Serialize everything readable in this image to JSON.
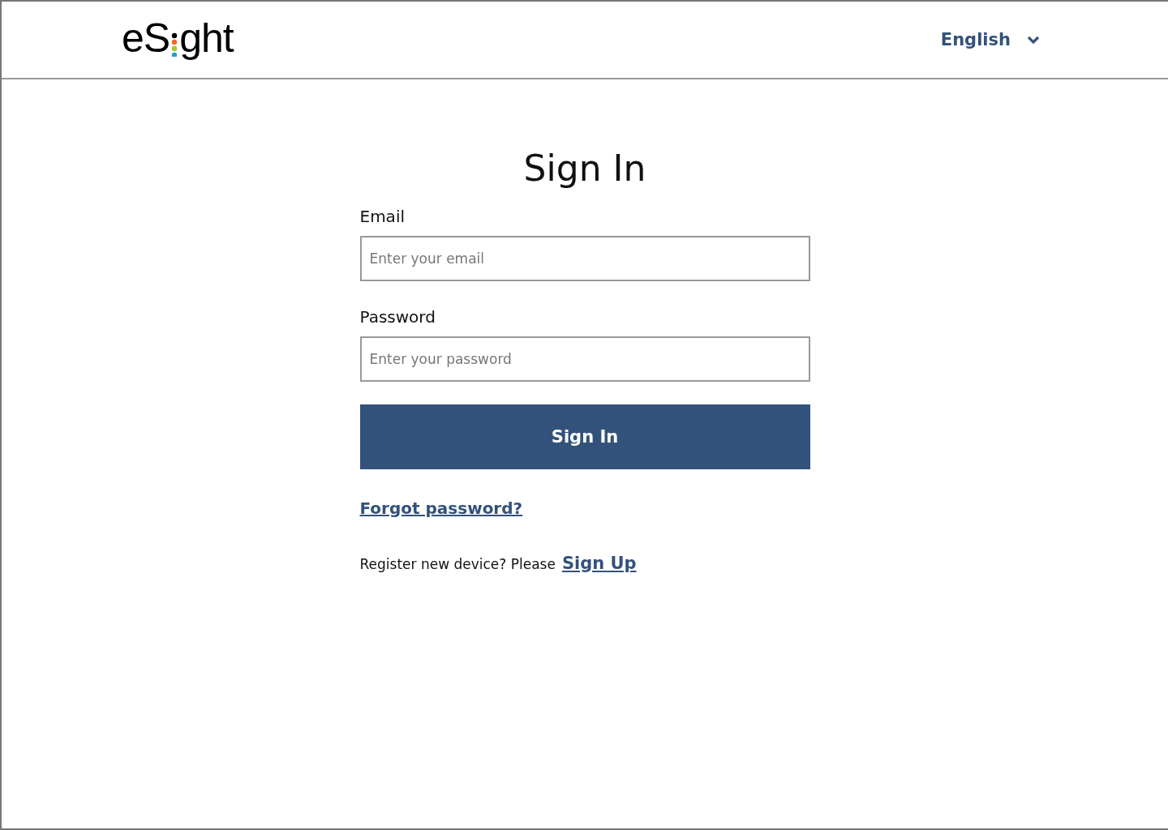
{
  "header": {
    "logo": {
      "start": "eS",
      "end": "ght"
    },
    "language": "English"
  },
  "form": {
    "title": "Sign In",
    "fields": [
      {
        "label": "Email",
        "placeholder": "Enter your email"
      },
      {
        "label": "Password",
        "placeholder": "Enter your password"
      }
    ],
    "submit": "Sign In",
    "forgot": "Forgot password?",
    "register": {
      "text": "Register new device? Please",
      "link": "Sign Up"
    }
  }
}
